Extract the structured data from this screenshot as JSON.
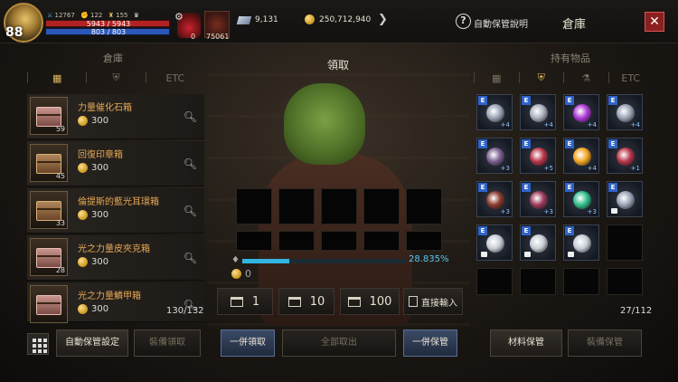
{
  "player": {
    "level": "88",
    "stat1": "12767",
    "stat2": "122",
    "stat3": "155",
    "hp": "5943 / 5943",
    "mp": "803 / 803",
    "slot_small_count": "0",
    "slot_item_count": "75061"
  },
  "currency": {
    "gems": "9,131",
    "gold": "250,712,940"
  },
  "header": {
    "help_label": "自動保管說明",
    "title": "倉庫",
    "close_icon": "close-icon"
  },
  "storage": {
    "heading": "倉庫",
    "tabs": [
      "grid-icon",
      "shield-icon",
      "ETC"
    ],
    "items": [
      {
        "name": "力量催化石箱",
        "price": "300",
        "count": "59",
        "style": "pink"
      },
      {
        "name": "回復印章箱",
        "price": "300",
        "count": "45",
        "style": "brown"
      },
      {
        "name": "倫提斯的藍光耳環箱",
        "price": "300",
        "count": "33",
        "style": "brown"
      },
      {
        "name": "光之力量皮夾克箱",
        "price": "300",
        "count": "28",
        "style": "pink"
      },
      {
        "name": "光之力量鱗甲箱",
        "price": "300",
        "count": "",
        "style": "pink"
      }
    ],
    "capacity": "130/132"
  },
  "withdraw": {
    "title": "領取",
    "progress_percent": "28.835%",
    "progress_fraction": 0.28835,
    "cost": "0",
    "qty_buttons": [
      "1",
      "10",
      "100"
    ],
    "direct_input": "直接輸入"
  },
  "inventory": {
    "heading": "持有物品",
    "tabs": [
      "grid-icon",
      "shield-icon",
      "potion-icon",
      "ETC"
    ],
    "capacity": "27/112",
    "slots": [
      {
        "plus": "+4",
        "lock": false,
        "gem": "#9aa3b5"
      },
      {
        "plus": "+4",
        "lock": false,
        "gem": "#aab0bd"
      },
      {
        "plus": "+4",
        "lock": false,
        "gem": "#b03ad6"
      },
      {
        "plus": "+4",
        "lock": false,
        "gem": "#9aa3b5"
      },
      {
        "plus": "+3",
        "lock": false,
        "gem": "#7b5f8f"
      },
      {
        "plus": "+5",
        "lock": false,
        "gem": "#b8364a"
      },
      {
        "plus": "+4",
        "lock": false,
        "gem": "#f2a623"
      },
      {
        "plus": "+1",
        "lock": false,
        "gem": "#b8364a"
      },
      {
        "plus": "+3",
        "lock": false,
        "gem": "#8a3a2e"
      },
      {
        "plus": "+3",
        "lock": false,
        "gem": "#9b3a5a"
      },
      {
        "plus": "+3",
        "lock": false,
        "gem": "#2fbf8a"
      },
      {
        "plus": "",
        "lock": true,
        "gem": "#9aa3b5"
      },
      {
        "plus": "",
        "lock": true,
        "gem": "#c8cdd6"
      },
      {
        "plus": "",
        "lock": true,
        "gem": "#c8cdd6"
      },
      {
        "plus": "",
        "lock": true,
        "gem": "#c8cdd6"
      }
    ]
  },
  "bottom": {
    "auto_setting": "自動保管設定",
    "equip_withdraw": "裝備領取",
    "all_withdraw": "一併領取",
    "take_all": "全部取出",
    "all_store": "一併保管",
    "material_store": "材料保管",
    "equip_store": "裝備保管"
  },
  "colors": {
    "accent_gold": "#e0b659",
    "item_name": "#e6a855",
    "progress": "#34b4e0",
    "close_red": "#8a1f1f"
  }
}
